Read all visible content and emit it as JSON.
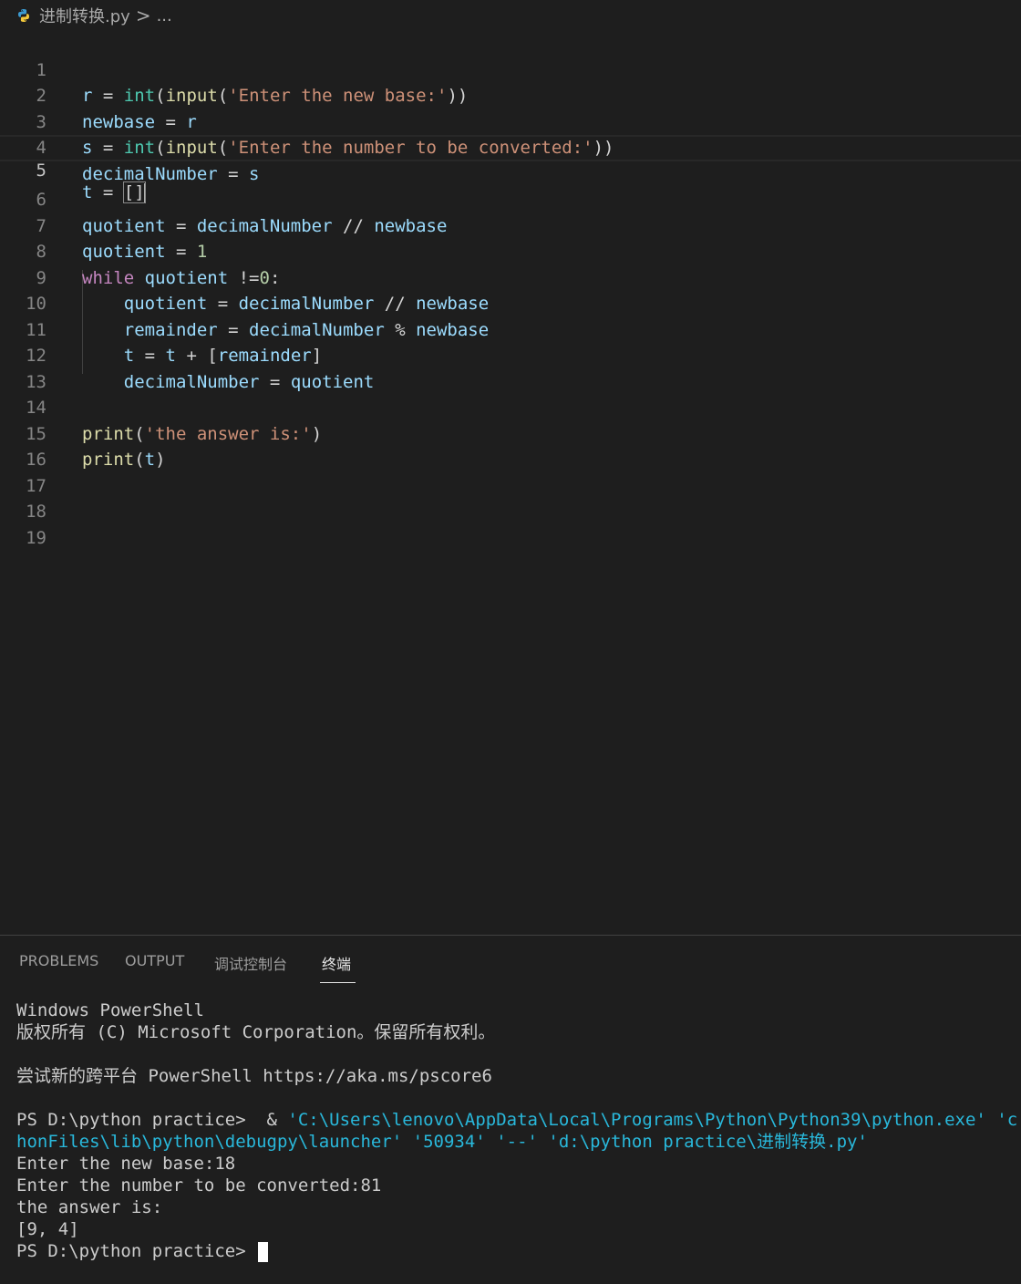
{
  "breadcrumb": {
    "file": "进制转换.py",
    "separator": ">",
    "more": "..."
  },
  "editor": {
    "current_line": 5,
    "lines": [
      {
        "n": "1"
      },
      {
        "n": "2"
      },
      {
        "n": "3"
      },
      {
        "n": "4"
      },
      {
        "n": "5"
      },
      {
        "n": "6"
      },
      {
        "n": "7"
      },
      {
        "n": "8"
      },
      {
        "n": "9"
      },
      {
        "n": "10"
      },
      {
        "n": "11"
      },
      {
        "n": "12"
      },
      {
        "n": "13"
      },
      {
        "n": "14"
      },
      {
        "n": "15"
      },
      {
        "n": "16"
      },
      {
        "n": "17"
      },
      {
        "n": "18"
      },
      {
        "n": "19"
      }
    ],
    "code": {
      "l1": [
        "r",
        " = ",
        "int",
        "(",
        "input",
        "(",
        "'Enter the new base:'",
        "))"
      ],
      "l2": [
        "newbase",
        " = ",
        "r"
      ],
      "l3": [
        "s",
        " = ",
        "int",
        "(",
        "input",
        "(",
        "'Enter the number to be converted:'",
        "))"
      ],
      "l4": [
        "decimalNumber",
        " = ",
        "s"
      ],
      "l5": [
        "t",
        " = ",
        "[]"
      ],
      "l6": [
        "quotient",
        " = ",
        "decimalNumber",
        " // ",
        "newbase"
      ],
      "l7": [
        "quotient",
        " = ",
        "1"
      ],
      "l8": [
        "while",
        " ",
        "quotient",
        " !=",
        "0",
        ":"
      ],
      "l9": [
        "    ",
        "quotient",
        " = ",
        "decimalNumber",
        " // ",
        "newbase"
      ],
      "l10": [
        "    ",
        "remainder",
        " = ",
        "decimalNumber",
        " % ",
        "newbase"
      ],
      "l11": [
        "    ",
        "t",
        " = ",
        "t",
        " + [",
        "remainder",
        "]"
      ],
      "l12": [
        "    ",
        "decimalNumber",
        " = ",
        "quotient"
      ],
      "l14": [
        "print",
        "(",
        "'the answer is:'",
        ")"
      ],
      "l15": [
        "print",
        "(",
        "t",
        ")"
      ]
    }
  },
  "panel": {
    "tabs": [
      {
        "label": "PROBLEMS"
      },
      {
        "label": "OUTPUT"
      },
      {
        "label": "调试控制台"
      },
      {
        "label": "终端"
      }
    ],
    "active_tab": "终端",
    "terminal": {
      "l1": "Windows PowerShell",
      "l2": "版权所有 (C) Microsoft Corporation。保留所有权利。",
      "l4": "尝试新的跨平台 PowerShell https://aka.ms/pscore6",
      "l6_prompt": "PS D:\\python practice>  & ",
      "l6_cmd": "'C:\\Users\\lenovo\\AppData\\Local\\Programs\\Python\\Python39\\python.exe' 'c:\\Use",
      "l7_cmd": "honFiles\\lib\\python\\debugpy\\launcher' '50934' '--' 'd:\\python practice\\进制转换.py'",
      "l8": "Enter the new base:18",
      "l9": "Enter the number to be converted:81",
      "l10": "the answer is:",
      "l11": "[9, 4]",
      "l12": "PS D:\\python practice> "
    }
  },
  "colors": {
    "background": "#1e1e1e",
    "variable": "#9cdcfe",
    "function": "#dcdcaa",
    "builtin": "#4ec9b0",
    "string": "#ce9178",
    "keyword": "#c586c0",
    "number": "#b5cea8",
    "terminal_link": "#29b8db"
  }
}
